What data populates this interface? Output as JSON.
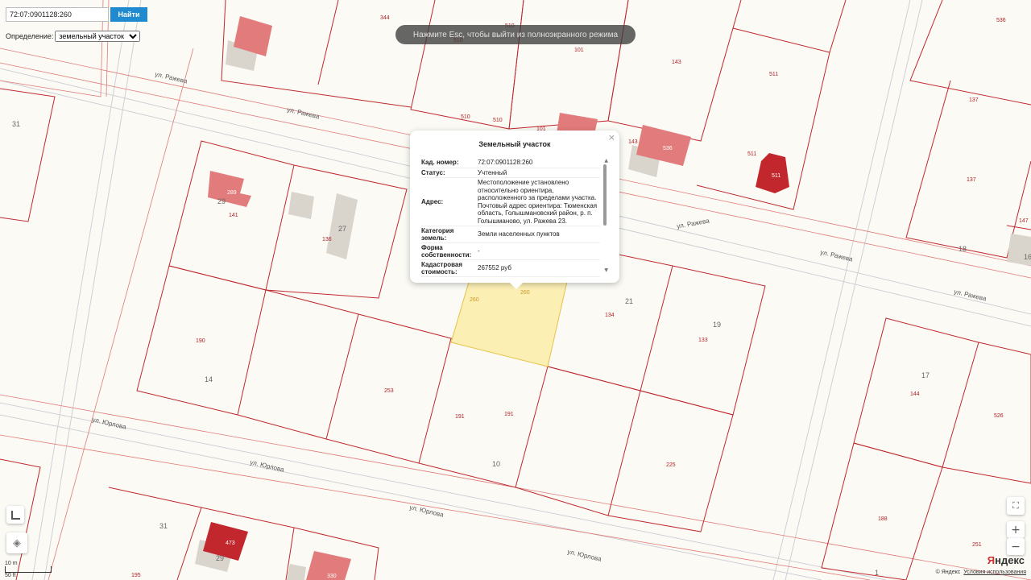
{
  "search": {
    "value": "72:07:0901128:260",
    "button_label": "Найти"
  },
  "definition": {
    "label": "Определение:",
    "selected": "земельный участок"
  },
  "fullscreen_hint": "Нажмите Esc, чтобы выйти из полноэкранного режима",
  "popup": {
    "title": "Земельный участок",
    "close_glyph": "×",
    "rows": [
      {
        "key": "Кад. номер:",
        "value": "72:07:0901128:260"
      },
      {
        "key": "Статус:",
        "value": "Учтенный"
      },
      {
        "key": "Адрес:",
        "value": "Местоположение установлено относительно ориентира, расположенного за пределами участка. Почтовый адрес ориентира: Тюменская область, Голышмановский район, р. п. Голышманово, ул. Ражева 23."
      },
      {
        "key": "Категория земель:",
        "value": "Земли населенных пунктов"
      },
      {
        "key": "Форма собственности:",
        "value": "-"
      },
      {
        "key": "Кадастровая стоимость:",
        "value": "267552 руб"
      }
    ]
  },
  "streets": {
    "razheva": "ул. Ражева",
    "yurlova": "ул. Юрлова"
  },
  "parcel_labels": {
    "p344": "344",
    "p510a": "510",
    "p510b": "510",
    "p510c": "510",
    "p510d": "510",
    "p101a": "101",
    "p101b": "101",
    "p143a": "143",
    "p143b": "143",
    "p511a": "511",
    "p511b": "511",
    "p536": "536",
    "p137a": "137",
    "p137b": "137",
    "p147": "147",
    "p289": "289",
    "p141": "141",
    "p136": "136",
    "p260a": "260",
    "p260b": "260",
    "p134": "134",
    "p133": "133",
    "p190": "190",
    "p253": "253",
    "p191a": "191",
    "p191b": "191",
    "p225": "225",
    "p144": "144",
    "p526": "526",
    "p188": "188",
    "p251": "251",
    "p195": "195"
  },
  "house_numbers": {
    "h31a": "31",
    "h29a": "29",
    "h27": "27",
    "h21": "21",
    "h19": "19",
    "h14": "14",
    "h10": "10",
    "h17": "17",
    "h18": "18",
    "h16": "16",
    "h31b": "31",
    "h29b": "29",
    "h1": "1"
  },
  "building_labels": {
    "b29": "289",
    "b536": "536",
    "b511": "511",
    "b473": "473",
    "b330": "330"
  },
  "scale": {
    "meters": "10 m",
    "feet": "50 ft"
  },
  "attribution": {
    "provider": "© Яндекс",
    "terms": "Условия использования"
  },
  "logo": {
    "ya": "Я",
    "rest": "ндекс"
  },
  "zoom": {
    "plus": "+",
    "minus": "−"
  },
  "colors": {
    "selected_parcel": "#fcefb4",
    "parcel_border": "#c0282e",
    "building": "#e27b7b",
    "building_dark": "#c1272d",
    "link": "#1f8ad0"
  }
}
